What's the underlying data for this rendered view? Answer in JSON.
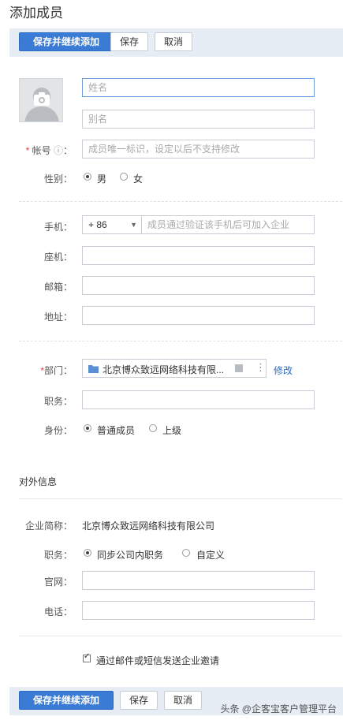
{
  "page": {
    "title": "添加成员"
  },
  "toolbar": {
    "save_continue": "保存并继续添加",
    "save": "保存",
    "cancel": "取消"
  },
  "form": {
    "name_placeholder": "姓名",
    "alias_placeholder": "别名",
    "account_label": "帐号",
    "account_required": "*",
    "account_info": "ⓘ",
    "account_colon": "：",
    "account_placeholder": "成员唯一标识，设定以后不支持修改",
    "gender_label": "性别：",
    "gender_male": "男",
    "gender_female": "女",
    "mobile_label": "手机：",
    "country_code": "+ 86",
    "mobile_placeholder": "成员通过验证该手机后可加入企业",
    "phone_label": "座机：",
    "email_label": "邮箱：",
    "address_label": "地址：",
    "dept_required": "*",
    "dept_label": "部门：",
    "dept_value": "北京博众致远网络科技有限...",
    "dept_modify": "修改",
    "position_label": "职务：",
    "identity_label": "身份：",
    "identity_normal": "普通成员",
    "identity_superior": "上级"
  },
  "external": {
    "section_title": "对外信息",
    "company_label": "企业简称：",
    "company_value": "北京博众致远网络科技有限公司",
    "position_label": "职务：",
    "position_sync": "同步公司内职务",
    "position_custom": "自定义",
    "website_label": "官网：",
    "tel_label": "电话："
  },
  "invite": {
    "label": "通过邮件或短信发送企业邀请"
  },
  "watermark": "头条 @企客宝客户管理平台"
}
